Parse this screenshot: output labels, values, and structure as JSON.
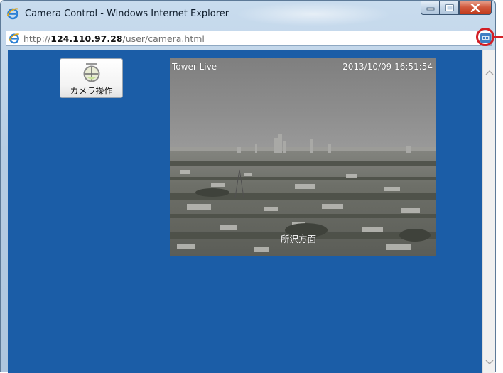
{
  "window": {
    "title": "Camera Control - Windows Internet Explorer",
    "icon": "ie-icon",
    "controls": [
      "minimize-icon",
      "maximize-icon",
      "close-icon"
    ]
  },
  "address_bar": {
    "url_scheme": "http://",
    "url_host": "124.110.97.28",
    "url_path": "/user/camera.html",
    "icon": "ie-page-icon",
    "right_icon": "compatibility-view-icon"
  },
  "camera_button": {
    "label": "カメラ操作",
    "icon": "camera-dome-icon"
  },
  "video": {
    "title": "Tower Live",
    "timestamp": "2013/10/09 16:51:54",
    "location": "所沢方面"
  },
  "colors": {
    "page_background": "#1b5da7",
    "annotation": "#d21f26"
  }
}
